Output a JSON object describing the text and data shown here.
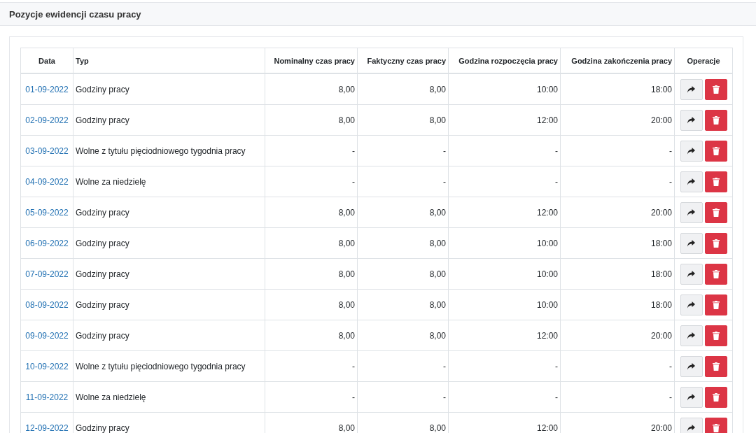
{
  "panel": {
    "title": "Pozycje ewidencji czasu pracy"
  },
  "table": {
    "columns": [
      "Data",
      "Typ",
      "Nominalny czas pracy",
      "Faktyczny czas pracy",
      "Godzina rozpoczęcia pracy",
      "Godzina zakończenia pracy",
      "Operacje"
    ],
    "rows": [
      {
        "date": "01-09-2022",
        "type": "Godziny pracy",
        "nominal": "8,00",
        "actual": "8,00",
        "start": "10:00",
        "end": "18:00"
      },
      {
        "date": "02-09-2022",
        "type": "Godziny pracy",
        "nominal": "8,00",
        "actual": "8,00",
        "start": "12:00",
        "end": "20:00"
      },
      {
        "date": "03-09-2022",
        "type": "Wolne z tytułu pięciodniowego tygodnia pracy",
        "nominal": "-",
        "actual": "-",
        "start": "-",
        "end": "-"
      },
      {
        "date": "04-09-2022",
        "type": "Wolne za niedzielę",
        "nominal": "-",
        "actual": "-",
        "start": "-",
        "end": "-"
      },
      {
        "date": "05-09-2022",
        "type": "Godziny pracy",
        "nominal": "8,00",
        "actual": "8,00",
        "start": "12:00",
        "end": "20:00"
      },
      {
        "date": "06-09-2022",
        "type": "Godziny pracy",
        "nominal": "8,00",
        "actual": "8,00",
        "start": "10:00",
        "end": "18:00"
      },
      {
        "date": "07-09-2022",
        "type": "Godziny pracy",
        "nominal": "8,00",
        "actual": "8,00",
        "start": "10:00",
        "end": "18:00"
      },
      {
        "date": "08-09-2022",
        "type": "Godziny pracy",
        "nominal": "8,00",
        "actual": "8,00",
        "start": "10:00",
        "end": "18:00"
      },
      {
        "date": "09-09-2022",
        "type": "Godziny pracy",
        "nominal": "8,00",
        "actual": "8,00",
        "start": "12:00",
        "end": "20:00"
      },
      {
        "date": "10-09-2022",
        "type": "Wolne z tytułu pięciodniowego tygodnia pracy",
        "nominal": "-",
        "actual": "-",
        "start": "-",
        "end": "-"
      },
      {
        "date": "11-09-2022",
        "type": "Wolne za niedzielę",
        "nominal": "-",
        "actual": "-",
        "start": "-",
        "end": "-"
      },
      {
        "date": "12-09-2022",
        "type": "Godziny pracy",
        "nominal": "8,00",
        "actual": "8,00",
        "start": "12:00",
        "end": "20:00"
      }
    ]
  }
}
